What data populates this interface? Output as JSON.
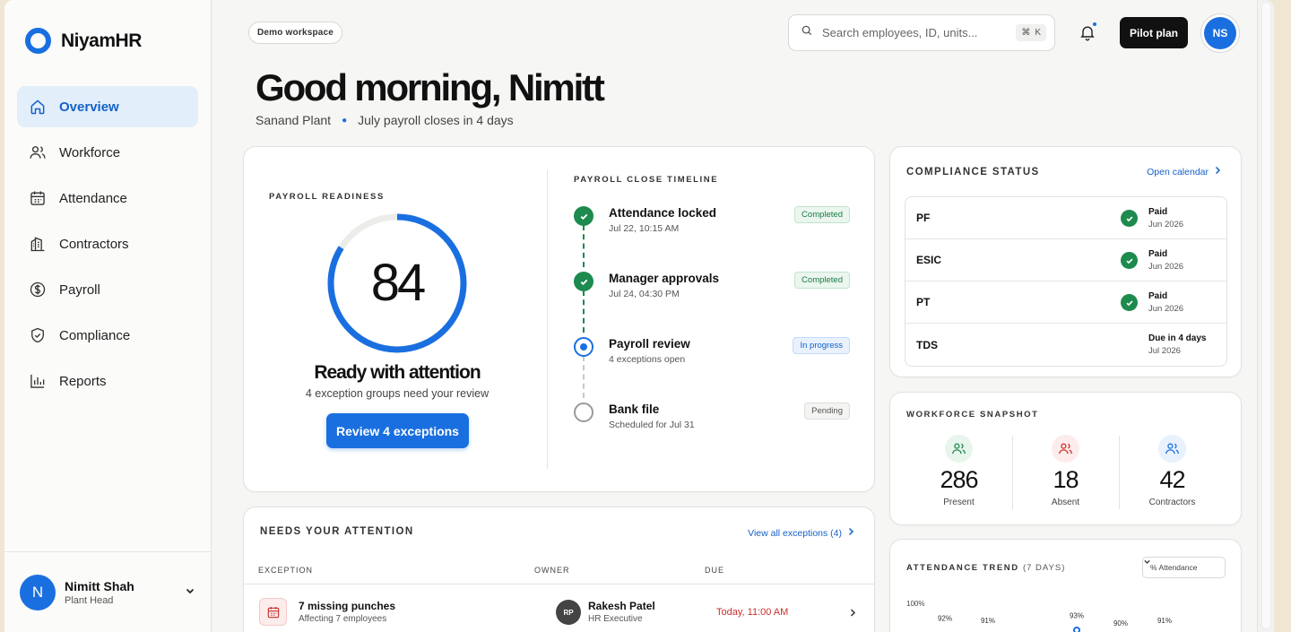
{
  "app": {
    "name": "NiyamHR",
    "accent": "#1a6fe0"
  },
  "sidebar": {
    "items": [
      {
        "label": "Overview",
        "icon": "home-icon",
        "active": true
      },
      {
        "label": "Workforce",
        "icon": "users-icon"
      },
      {
        "label": "Attendance",
        "icon": "calendar-icon"
      },
      {
        "label": "Contractors",
        "icon": "building-icon"
      },
      {
        "label": "Payroll",
        "icon": "dollar-icon"
      },
      {
        "label": "Compliance",
        "icon": "shield-icon"
      },
      {
        "label": "Reports",
        "icon": "bar-chart-icon"
      }
    ],
    "user": {
      "initial": "N",
      "name": "Nimitt Shah",
      "role": "Plant Head"
    }
  },
  "header": {
    "chip": "Demo workspace",
    "search_placeholder": "Search employees, ID, units...",
    "shortcut_symbol": "⌘",
    "shortcut_key": "K",
    "pilot_label": "Pilot plan",
    "avatar_initials": "NS",
    "greeting": "Good morning, Nimitt",
    "plant": "Sanand Plant",
    "payroll_note": "July payroll closes in 4 days"
  },
  "readiness": {
    "eyebrow": "PAYROLL READINESS",
    "score": "84",
    "score_fraction": 0.84,
    "title": "Ready with attention",
    "subtitle": "4 exception groups need your review",
    "button": "Review 4 exceptions"
  },
  "timeline": {
    "eyebrow": "PAYROLL CLOSE TIMELINE",
    "items": [
      {
        "title": "Attendance locked",
        "sub": "Jul 22, 10:15 AM",
        "status": "Completed",
        "state": "done"
      },
      {
        "title": "Manager approvals",
        "sub": "Jul 24, 04:30 PM",
        "status": "Completed",
        "state": "done"
      },
      {
        "title": "Payroll review",
        "sub": "4 exceptions open",
        "status": "In progress",
        "state": "active"
      },
      {
        "title": "Bank file",
        "sub": "Scheduled for Jul 31",
        "status": "Pending",
        "state": "pending"
      }
    ]
  },
  "compliance": {
    "eyebrow": "COMPLIANCE STATUS",
    "link": "Open calendar",
    "rows": [
      {
        "name": "PF",
        "status": "Paid",
        "date": "Jun 2026",
        "state": "ok"
      },
      {
        "name": "ESIC",
        "status": "Paid",
        "date": "Jun 2026",
        "state": "ok"
      },
      {
        "name": "PT",
        "status": "Paid",
        "date": "Jun 2026",
        "state": "ok"
      },
      {
        "name": "TDS",
        "status": "Due in 4 days",
        "date": "Jul 2026",
        "state": "due"
      }
    ]
  },
  "workforce": {
    "eyebrow": "WORKFORCE SNAPSHOT",
    "stats": [
      {
        "value": "286",
        "label": "Present",
        "color": "#1d8a4e",
        "bg": "#e8f5ed"
      },
      {
        "value": "18",
        "label": "Absent",
        "color": "#c9302c",
        "bg": "#fdecec"
      },
      {
        "value": "42",
        "label": "Contractors",
        "color": "#1a6fe0",
        "bg": "#e8f1fc"
      }
    ]
  },
  "trend": {
    "eyebrow": "ATTENDANCE TREND",
    "eyebrow_muted": "(7 DAYS)",
    "select": "% Attendance",
    "y_label": "100%"
  },
  "chart_data": {
    "type": "line",
    "values": [
      92,
      91,
      null,
      93,
      90,
      91
    ],
    "labels": [
      "92%",
      "91%",
      "",
      "93%",
      "90%",
      "91%"
    ],
    "ymax": 100
  },
  "attention": {
    "eyebrow": "NEEDS YOUR ATTENTION",
    "link": "View all exceptions (4)",
    "columns": [
      "EXCEPTION",
      "OWNER",
      "DUE"
    ],
    "rows": [
      {
        "title": "7 missing punches",
        "sub": "Affecting 7 employees",
        "owner_initials": "RP",
        "owner": "Rakesh Patel",
        "owner_role": "HR Executive",
        "due": "Today, 11:00 AM"
      }
    ]
  }
}
